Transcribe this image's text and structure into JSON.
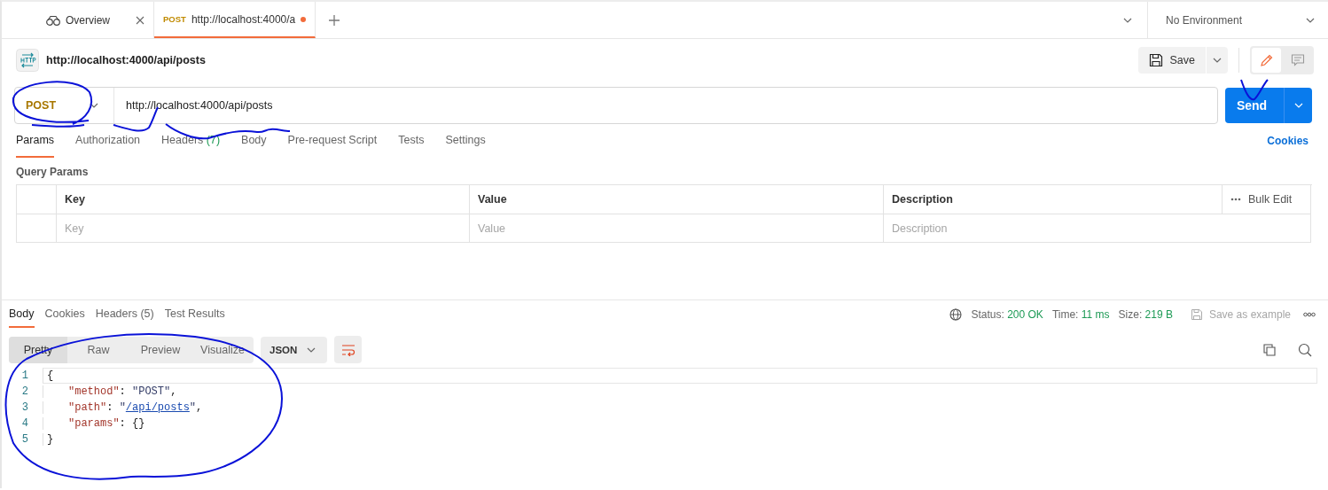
{
  "tabs": [
    {
      "kind": "overview",
      "label": "Overview",
      "selected": false,
      "closable": true
    },
    {
      "kind": "request",
      "method": "POST",
      "label": "http://localhost:4000/a",
      "selected": true,
      "unsaved": true
    }
  ],
  "environment": {
    "label": "No Environment"
  },
  "request": {
    "title": "http://localhost:4000/api/posts",
    "save_label": "Save",
    "method": "POST",
    "url": "http://localhost:4000/api/posts",
    "send_label": "Send",
    "tabs": [
      {
        "label": "Params",
        "selected": true
      },
      {
        "label": "Authorization",
        "selected": false
      },
      {
        "label": "Headers",
        "count": "(7)",
        "selected": false
      },
      {
        "label": "Body",
        "selected": false
      },
      {
        "label": "Pre-request Script",
        "selected": false
      },
      {
        "label": "Tests",
        "selected": false
      },
      {
        "label": "Settings",
        "selected": false
      }
    ],
    "cookies_link": "Cookies",
    "query_params": {
      "title": "Query Params",
      "columns": [
        "Key",
        "Value",
        "Description"
      ],
      "bulk_edit": "Bulk Edit",
      "placeholders": [
        "Key",
        "Value",
        "Description"
      ]
    }
  },
  "response": {
    "tabs": [
      {
        "label": "Body",
        "selected": true
      },
      {
        "label": "Cookies",
        "selected": false
      },
      {
        "label": "Headers",
        "count": "(5)",
        "selected": false
      },
      {
        "label": "Test Results",
        "selected": false
      }
    ],
    "stats": [
      {
        "label": "Status:",
        "value": "200 OK"
      },
      {
        "label": "Time:",
        "value": "11 ms"
      },
      {
        "label": "Size:",
        "value": "219 B"
      }
    ],
    "save_example": "Save as example",
    "views": [
      {
        "label": "Pretty",
        "selected": true
      },
      {
        "label": "Raw",
        "selected": false
      },
      {
        "label": "Preview",
        "selected": false
      },
      {
        "label": "Visualize",
        "selected": false
      }
    ],
    "format": "JSON",
    "lines": [
      {
        "number": "1",
        "indented": false,
        "tokens": [
          {
            "kind": "punct",
            "text": "{"
          }
        ]
      },
      {
        "number": "2",
        "indented": true,
        "tokens": [
          {
            "kind": "key",
            "text": "\"method\""
          },
          {
            "kind": "punct",
            "text": ": "
          },
          {
            "kind": "string",
            "text": "\"POST\""
          },
          {
            "kind": "punct",
            "text": ","
          }
        ]
      },
      {
        "number": "3",
        "indented": true,
        "tokens": [
          {
            "kind": "key",
            "text": "\"path\""
          },
          {
            "kind": "punct",
            "text": ": "
          },
          {
            "kind": "string",
            "text": "\""
          },
          {
            "kind": "link",
            "text": "/api/posts"
          },
          {
            "kind": "string",
            "text": "\""
          },
          {
            "kind": "punct",
            "text": ","
          }
        ]
      },
      {
        "number": "4",
        "indented": true,
        "tokens": [
          {
            "kind": "key",
            "text": "\"params\""
          },
          {
            "kind": "punct",
            "text": ": "
          },
          {
            "kind": "punct",
            "text": "{}"
          }
        ]
      },
      {
        "number": "5",
        "indented": false,
        "tokens": [
          {
            "kind": "punct",
            "text": "}"
          }
        ]
      }
    ]
  }
}
